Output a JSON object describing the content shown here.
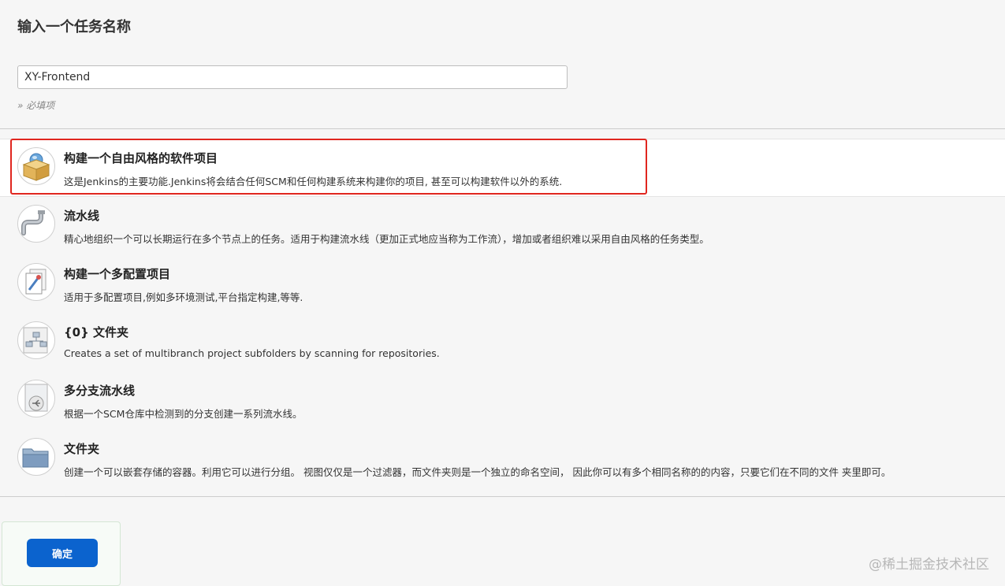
{
  "header": {
    "title": "输入一个任务名称"
  },
  "name_field": {
    "value": "XY-Frontend",
    "hint": "» 必填项"
  },
  "job_types": [
    {
      "label": "构建一个自由风格的软件项目",
      "description": "这是Jenkins的主要功能.Jenkins将会结合任何SCM和任何构建系统来构建你的项目, 甚至可以构建软件以外的系统.",
      "icon": "freestyle-box-icon",
      "selected": true
    },
    {
      "label": "流水线",
      "description": "精心地组织一个可以长期运行在多个节点上的任务。适用于构建流水线（更加正式地应当称为工作流），增加或者组织难以采用自由风格的任务类型。",
      "icon": "pipeline-icon",
      "selected": false
    },
    {
      "label": "构建一个多配置项目",
      "description": "适用于多配置项目,例如多环境测试,平台指定构建,等等.",
      "icon": "multi-config-icon",
      "selected": false
    },
    {
      "label": "{0} 文件夹",
      "description": "Creates a set of multibranch project subfolders by scanning for repositories.",
      "icon": "org-folder-icon",
      "selected": false
    },
    {
      "label": "多分支流水线",
      "description": "根据一个SCM仓库中检测到的分支创建一系列流水线。",
      "icon": "multibranch-icon",
      "selected": false
    },
    {
      "label": "文件夹",
      "description": "创建一个可以嵌套存储的容器。利用它可以进行分组。 视图仅仅是一个过滤器，而文件夹则是一个独立的命名空间， 因此你可以有多个相同名称的的内容，只要它们在不同的文件 夹里即可。",
      "icon": "folder-icon",
      "selected": false
    }
  ],
  "footer": {
    "ok_label": "确定"
  },
  "watermark": "@稀土掘金技术社区",
  "colors": {
    "accent": "#0b63ce",
    "highlight": "#e0261f"
  }
}
